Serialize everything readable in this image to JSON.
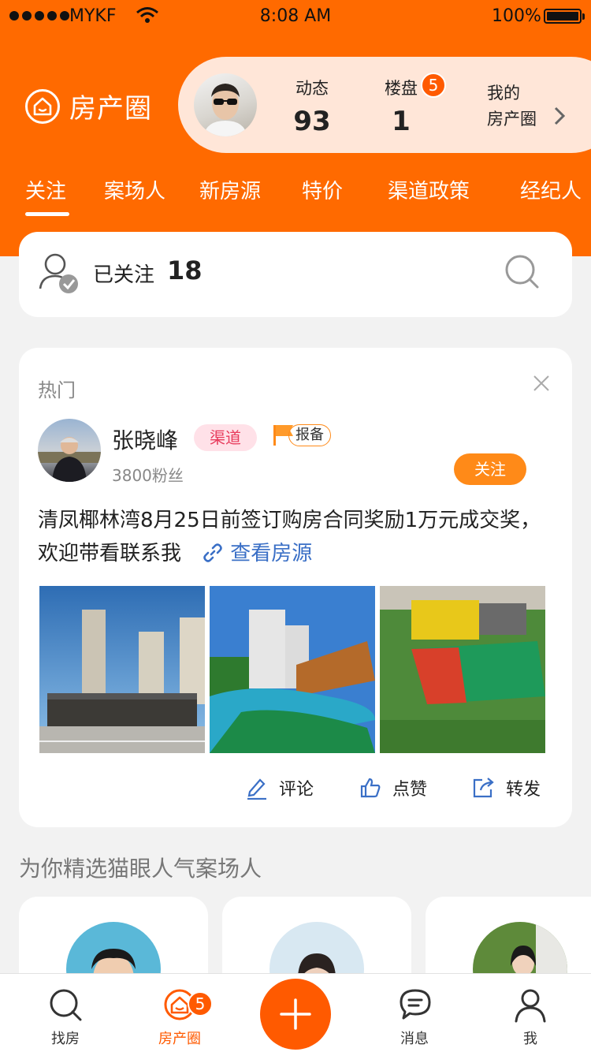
{
  "status_bar": {
    "carrier": "MYKF",
    "time": "8:08 AM",
    "battery": "100%"
  },
  "header": {
    "brand": "房产圈",
    "stats": [
      {
        "label": "动态",
        "value": "93"
      },
      {
        "label": "楼盘",
        "value": "1"
      }
    ],
    "loupan_badge": "5",
    "mine_line1": "我的",
    "mine_line2": "房产圈"
  },
  "tabs": [
    "关注",
    "案场人",
    "新房源",
    "特价",
    "渠道政策",
    "经纪人"
  ],
  "follow": {
    "label": "已关注",
    "count": "18"
  },
  "post": {
    "section": "热门",
    "author": "张晓峰",
    "tag_channel": "渠道",
    "tag_report": "报备",
    "fans": "3800粉丝",
    "follow_button": "关注",
    "text": "清凤椰林湾8月25日前签订购房合同奖励1万元成交奖，欢迎带看联系我",
    "link": "查看房源",
    "actions": {
      "comment": "评论",
      "like": "点赞",
      "share": "转发"
    }
  },
  "recommend": {
    "title": "为你精选猫眼人气案场人"
  },
  "bottom_nav": {
    "find": "找房",
    "circle": "房产圈",
    "circle_badge": "5",
    "message": "消息",
    "me": "我"
  },
  "colors": {
    "brand_orange": "#ff6a00",
    "link_blue": "#3a6fc6",
    "tag_pink": "#e83b5c"
  }
}
